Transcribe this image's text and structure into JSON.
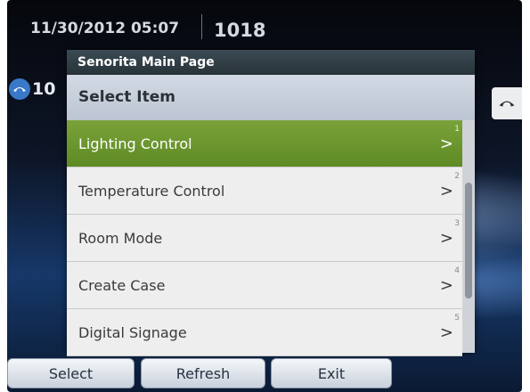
{
  "status": {
    "datetime": "11/30/2012 05:07",
    "extension": "1018"
  },
  "lines": {
    "left_label": "10"
  },
  "dialog": {
    "title": "Senorita Main Page",
    "header": "Select Item",
    "items": [
      {
        "label": "Lighting Control",
        "index": "1",
        "selected": true
      },
      {
        "label": "Temperature Control",
        "index": "2",
        "selected": false
      },
      {
        "label": "Room Mode",
        "index": "3",
        "selected": false
      },
      {
        "label": "Create Case",
        "index": "4",
        "selected": false
      },
      {
        "label": "Digital Signage",
        "index": "5",
        "selected": false
      }
    ],
    "chevron": ">"
  },
  "softkeys": {
    "select": "Select",
    "refresh": "Refresh",
    "exit": "Exit"
  },
  "colors": {
    "selected_item": "#6b9630",
    "title_bar": "#2f3c44",
    "background": "#0d1a33"
  },
  "icons": {
    "line_key": "handset-icon",
    "item_arrow": "chevron-right-icon"
  }
}
